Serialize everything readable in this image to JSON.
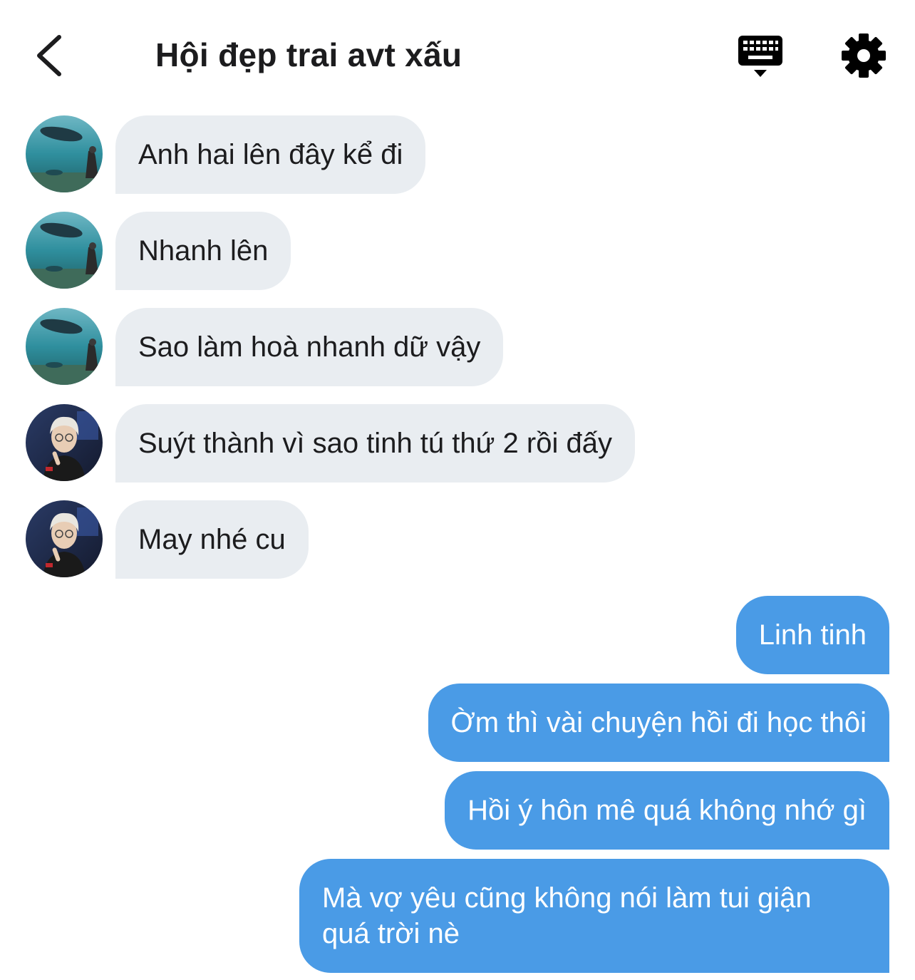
{
  "header": {
    "title": "Hội đẹp trai avt xấu",
    "back_icon": "chevron-left-icon",
    "keyboard_icon": "keyboard-icon",
    "settings_icon": "gear-icon"
  },
  "colors": {
    "incoming_bubble": "#e9edf1",
    "outgoing_bubble": "#4a9be6",
    "outgoing_text": "#ffffff",
    "text": "#1c1c1e"
  },
  "messages": {
    "incoming": [
      {
        "sender_avatar": "aquarium-avatar",
        "text": "Anh hai lên đây kể đi"
      },
      {
        "sender_avatar": "aquarium-avatar",
        "text": "Nhanh lên"
      },
      {
        "sender_avatar": "aquarium-avatar",
        "text": "Sao làm hoà nhanh dữ vậy"
      },
      {
        "sender_avatar": "gamer-avatar",
        "text": "Suýt thành vì sao tinh tú thứ 2 rồi đấy"
      },
      {
        "sender_avatar": "gamer-avatar",
        "text": "May nhé cu"
      }
    ],
    "outgoing": [
      {
        "text": "Linh tinh"
      },
      {
        "text": "Ờm thì vài chuyện hồi đi học thôi"
      },
      {
        "text": "Hồi ý hôn mê quá không nhớ gì"
      },
      {
        "text": "Mà vợ yêu cũng không nói làm tui giận quá trời nè"
      }
    ]
  }
}
